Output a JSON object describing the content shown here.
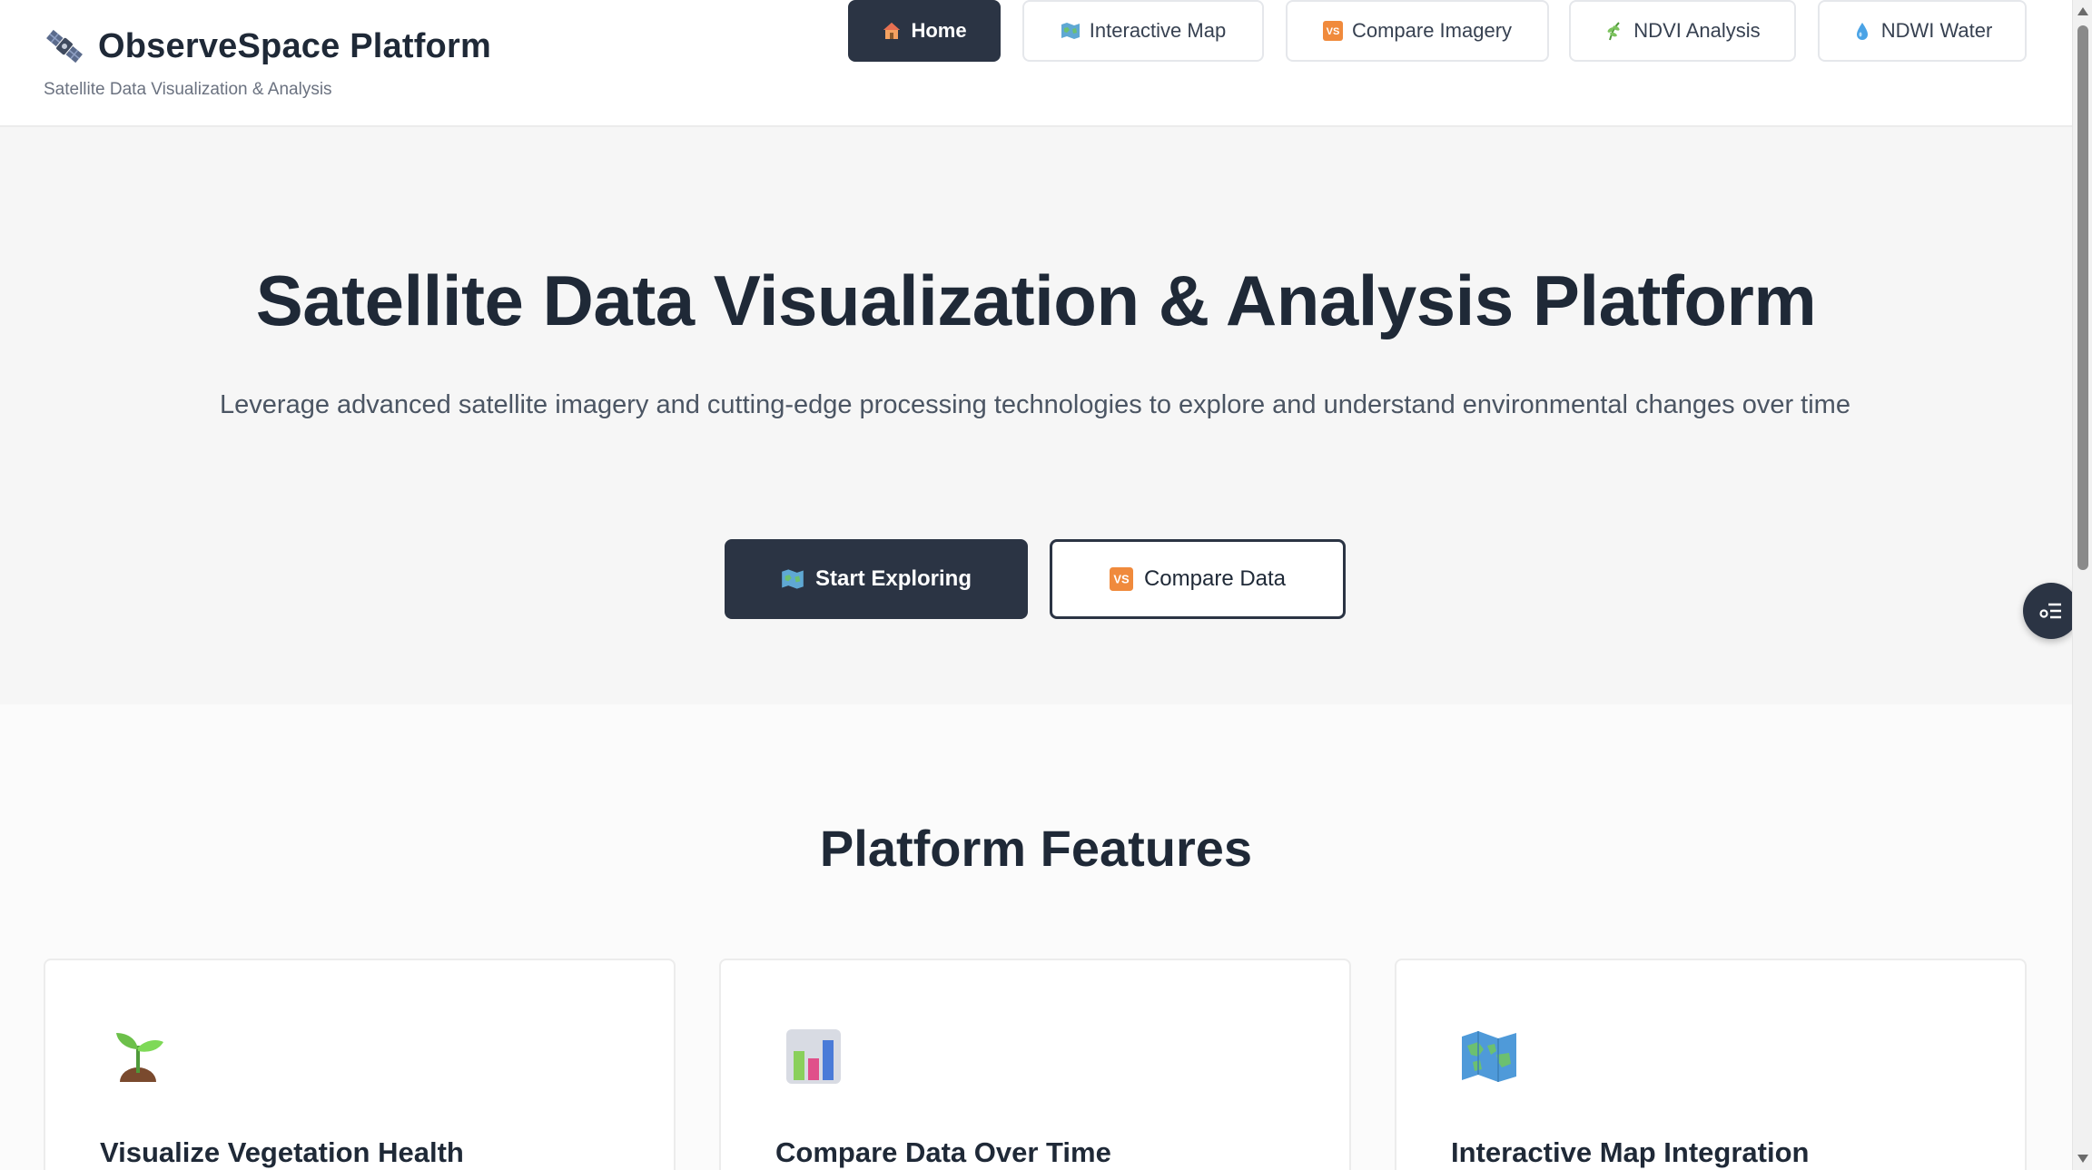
{
  "header": {
    "title": "ObserveSpace Platform",
    "subtitle": "Satellite Data Visualization & Analysis",
    "logo_icon": "satellite-icon"
  },
  "nav": {
    "items": [
      {
        "label": "Home",
        "icon": "house-icon",
        "active": true
      },
      {
        "label": "Interactive Map",
        "icon": "map-icon",
        "active": false
      },
      {
        "label": "Compare Imagery",
        "icon": "vs-icon",
        "active": false
      },
      {
        "label": "NDVI Analysis",
        "icon": "plant-icon",
        "active": false
      },
      {
        "label": "NDWI Water",
        "icon": "droplet-icon",
        "active": false
      }
    ]
  },
  "hero": {
    "title": "Satellite Data Visualization & Analysis Platform",
    "description": "Leverage advanced satellite imagery and cutting-edge processing technologies to explore and understand environmental changes over time",
    "primary_cta": "Start Exploring",
    "secondary_cta": "Compare Data"
  },
  "features": {
    "heading": "Platform Features",
    "cards": [
      {
        "title": "Visualize Vegetation Health",
        "icon": "seedling-icon"
      },
      {
        "title": "Compare Data Over Time",
        "icon": "bar-chart-icon"
      },
      {
        "title": "Interactive Map Integration",
        "icon": "world-map-icon"
      }
    ]
  },
  "colors": {
    "primary": "#2b3444",
    "accent_orange": "#f08a3c",
    "background": "#f6f6f6"
  }
}
